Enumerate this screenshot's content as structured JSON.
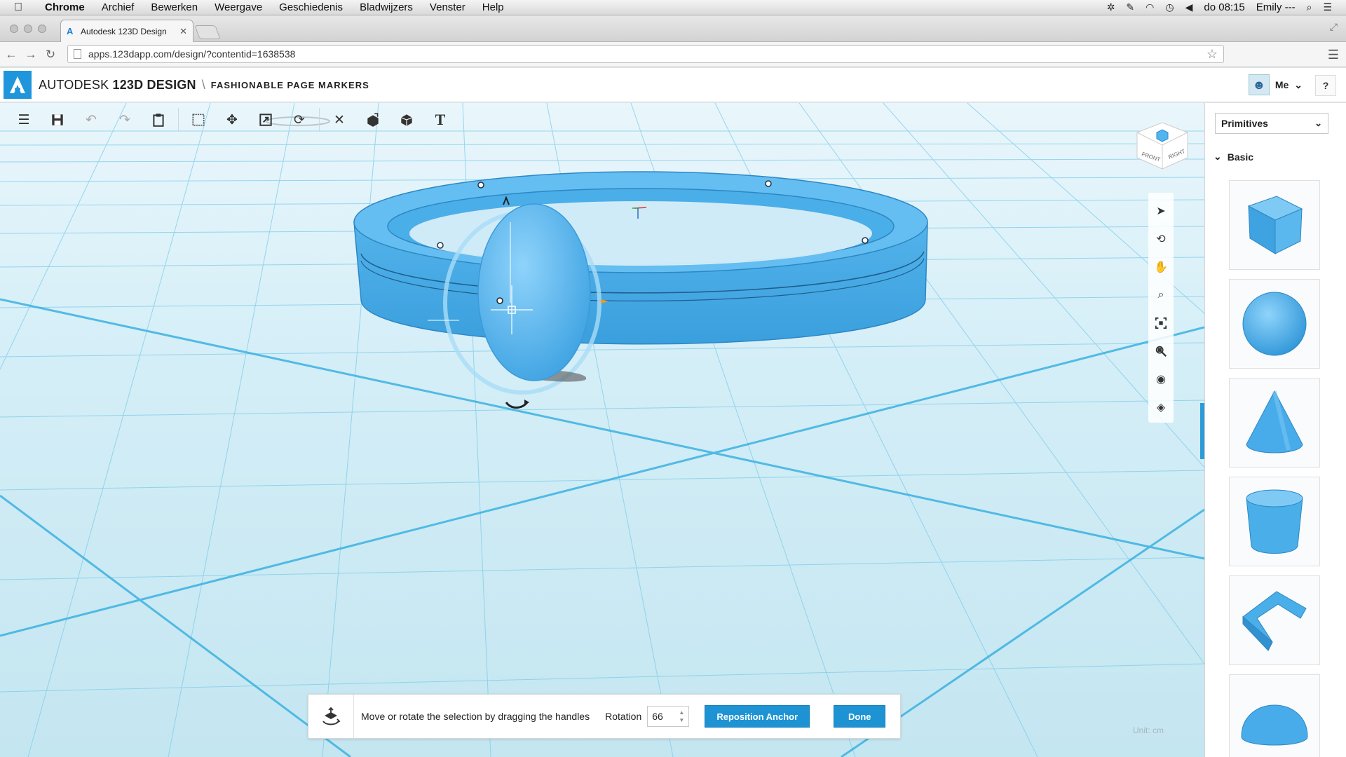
{
  "menubar": {
    "items": [
      "Chrome",
      "Archief",
      "Bewerken",
      "Weergave",
      "Geschiedenis",
      "Bladwijzers",
      "Venster",
      "Help"
    ],
    "clock": "do 08:15",
    "user": "Emily ---"
  },
  "browser": {
    "tab_title": "Autodesk 123D Design",
    "url": "apps.123dapp.com/design/?contentid=1638538"
  },
  "app": {
    "brand_prefix": "AUTODESK",
    "brand_name": "123D DESIGN",
    "separator": "\\",
    "project_name": "FASHIONABLE PAGE MARKERS",
    "user_label": "Me",
    "help_label": "?"
  },
  "viewcube": {
    "front_label": "FRONT",
    "right_label": "RIGHT"
  },
  "prompt": {
    "message": "Move or rotate the selection by dragging the handles",
    "rotation_label": "Rotation",
    "rotation_value": "66",
    "reposition_label": "Reposition Anchor",
    "done_label": "Done"
  },
  "unit": "Unit:  cm",
  "panel": {
    "select_value": "Primitives",
    "section_title": "Basic",
    "primitives": [
      "box",
      "sphere",
      "cone",
      "cylinder",
      "polygon",
      "hemisphere"
    ]
  },
  "colors": {
    "accent": "#1d93d4",
    "model": "#4aaee9",
    "grid": "#6cc3e8"
  }
}
